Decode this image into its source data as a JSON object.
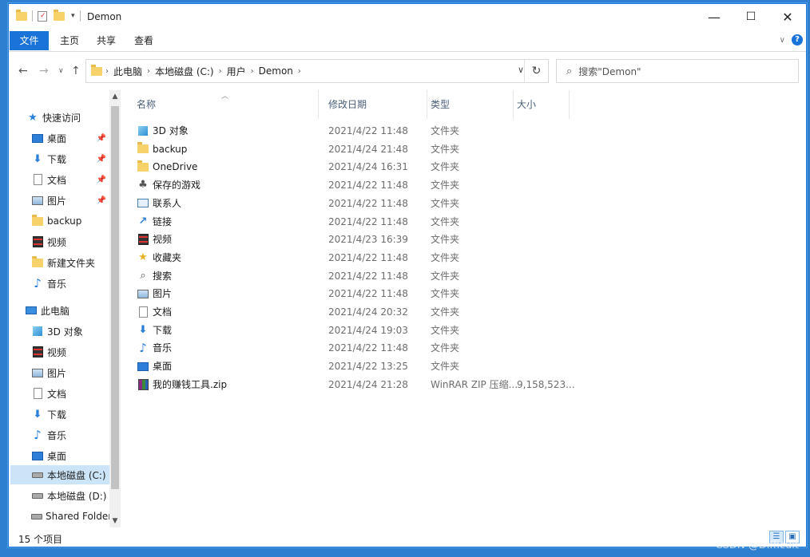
{
  "window": {
    "title": "Demon",
    "controls": {
      "minimize": "—",
      "maximize": "☐",
      "close": "✕"
    }
  },
  "ribbon": {
    "tabs": [
      "文件",
      "主页",
      "共享",
      "查看"
    ],
    "help": "?"
  },
  "address": {
    "crumbs": [
      "此电脑",
      "本地磁盘 (C:)",
      "用户",
      "Demon"
    ]
  },
  "search": {
    "placeholder": "搜索\"Demon\""
  },
  "nav": {
    "quick_access": "快速访问",
    "quick_items": [
      {
        "label": "桌面",
        "icon": "desktop-icon",
        "pinned": true
      },
      {
        "label": "下载",
        "icon": "download-icon",
        "pinned": true
      },
      {
        "label": "文档",
        "icon": "document-icon",
        "pinned": true
      },
      {
        "label": "图片",
        "icon": "picture-icon",
        "pinned": true
      },
      {
        "label": "backup",
        "icon": "folder-icon",
        "pinned": false
      },
      {
        "label": "视频",
        "icon": "video-icon",
        "pinned": false
      },
      {
        "label": "新建文件夹",
        "icon": "folder-icon",
        "pinned": false
      },
      {
        "label": "音乐",
        "icon": "music-icon",
        "pinned": false
      }
    ],
    "this_pc": "此电脑",
    "pc_items": [
      {
        "label": "3D 对象",
        "icon": "cube-icon"
      },
      {
        "label": "视频",
        "icon": "video-icon"
      },
      {
        "label": "图片",
        "icon": "picture-icon"
      },
      {
        "label": "文档",
        "icon": "document-icon"
      },
      {
        "label": "下载",
        "icon": "download-icon"
      },
      {
        "label": "音乐",
        "icon": "music-icon"
      },
      {
        "label": "桌面",
        "icon": "desktop-icon"
      },
      {
        "label": "本地磁盘 (C:)",
        "icon": "drive-icon",
        "selected": true
      },
      {
        "label": "本地磁盘 (D:)",
        "icon": "drive-icon"
      },
      {
        "label": "Shared Folders",
        "icon": "network-drive-icon"
      }
    ]
  },
  "list": {
    "columns": [
      "名称",
      "修改日期",
      "类型",
      "大小"
    ],
    "rows": [
      {
        "name": "3D 对象",
        "date": "2021/4/22 11:48",
        "type": "文件夹",
        "size": "",
        "icon": "cube-icon"
      },
      {
        "name": "backup",
        "date": "2021/4/24 21:48",
        "type": "文件夹",
        "size": "",
        "icon": "folder-icon"
      },
      {
        "name": "OneDrive",
        "date": "2021/4/24 16:31",
        "type": "文件夹",
        "size": "",
        "icon": "folder-icon"
      },
      {
        "name": "保存的游戏",
        "date": "2021/4/22 11:48",
        "type": "文件夹",
        "size": "",
        "icon": "saved-games-icon"
      },
      {
        "name": "联系人",
        "date": "2021/4/22 11:48",
        "type": "文件夹",
        "size": "",
        "icon": "contacts-icon"
      },
      {
        "name": "链接",
        "date": "2021/4/22 11:48",
        "type": "文件夹",
        "size": "",
        "icon": "link-icon"
      },
      {
        "name": "视频",
        "date": "2021/4/23 16:39",
        "type": "文件夹",
        "size": "",
        "icon": "video-icon"
      },
      {
        "name": "收藏夹",
        "date": "2021/4/22 11:48",
        "type": "文件夹",
        "size": "",
        "icon": "favorites-icon"
      },
      {
        "name": "搜索",
        "date": "2021/4/22 11:48",
        "type": "文件夹",
        "size": "",
        "icon": "search-icon"
      },
      {
        "name": "图片",
        "date": "2021/4/22 11:48",
        "type": "文件夹",
        "size": "",
        "icon": "picture-icon"
      },
      {
        "name": "文档",
        "date": "2021/4/24 20:32",
        "type": "文件夹",
        "size": "",
        "icon": "document-icon"
      },
      {
        "name": "下载",
        "date": "2021/4/24 19:03",
        "type": "文件夹",
        "size": "",
        "icon": "download-icon"
      },
      {
        "name": "音乐",
        "date": "2021/4/22 11:48",
        "type": "文件夹",
        "size": "",
        "icon": "music-icon"
      },
      {
        "name": "桌面",
        "date": "2021/4/22 13:25",
        "type": "文件夹",
        "size": "",
        "icon": "desktop-icon"
      },
      {
        "name": "我的赚钱工具.zip",
        "date": "2021/4/24 21:28",
        "type": "WinRAR ZIP 压缩...",
        "size": "9,158,523...",
        "icon": "winrar-zip-icon"
      }
    ]
  },
  "status": {
    "item_count": "15 个项目"
  },
  "watermark": "CSDN @Difficult"
}
